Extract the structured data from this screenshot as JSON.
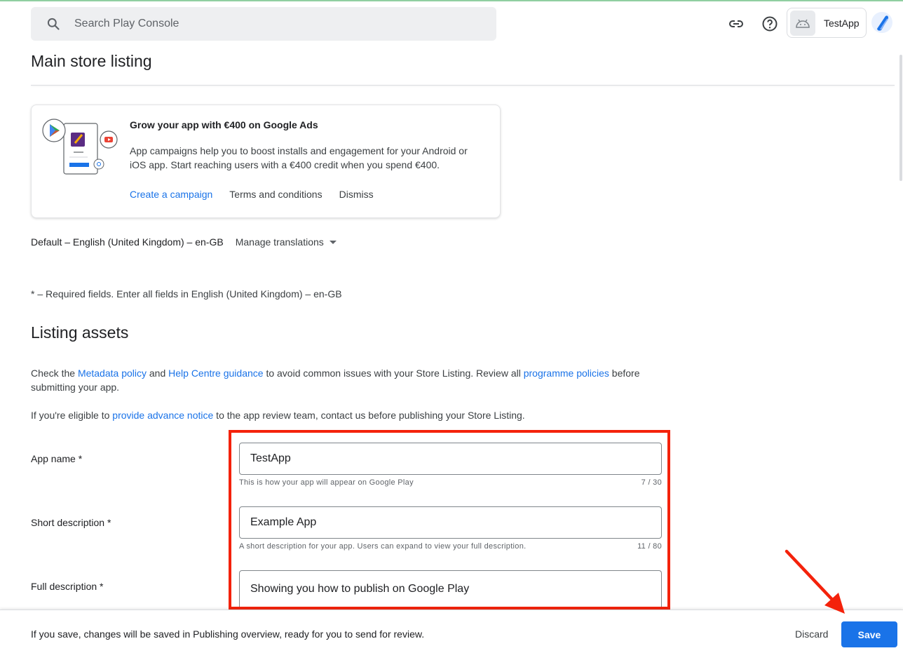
{
  "header": {
    "search_placeholder": "Search Play Console",
    "app_name": "TestApp",
    "icons": [
      "search-icon",
      "link-icon",
      "help-icon",
      "android-icon",
      "avatar"
    ]
  },
  "page": {
    "title": "Main store listing"
  },
  "promo": {
    "title": "Grow your app with €400 on Google Ads",
    "body": "App campaigns help you to boost installs and engagement for your Android or iOS app. Start reaching users with a €400 credit when you spend €400.",
    "create_campaign": "Create a campaign",
    "terms": "Terms and conditions",
    "dismiss": "Dismiss"
  },
  "language": {
    "default": "Default – English (United Kingdom) – en-GB",
    "manage_translations": "Manage translations"
  },
  "required_note": "* – Required fields. Enter all fields in English (United Kingdom) – en-GB",
  "listing_assets": {
    "heading": "Listing assets",
    "p1_a": "Check the ",
    "p1_metadata": "Metadata policy",
    "p1_b": " and ",
    "p1_help": "Help Centre guidance",
    "p1_c": " to avoid common issues with your Store Listing. Review all ",
    "p1_programme": "programme policies",
    "p1_d": " before submitting your app.",
    "p2_a": "If you're eligible to ",
    "p2_link": "provide advance notice",
    "p2_b": " to the app review team, contact us before publishing your Store Listing."
  },
  "fields": {
    "app_name": {
      "label": "App name  *",
      "value": "TestApp",
      "helper": "This is how your app will appear on Google Play",
      "counter": "7 / 30"
    },
    "short_description": {
      "label": "Short description  *",
      "value": "Example App",
      "helper": "A short description for your app. Users can expand to view your full description.",
      "counter": "11 / 80"
    },
    "full_description": {
      "label": "Full description  *",
      "value": "Showing you how to publish on Google Play"
    }
  },
  "footer": {
    "message": "If you save, changes will be saved in Publishing overview, ready for you to send for review.",
    "discard": "Discard",
    "save": "Save"
  },
  "colors": {
    "accent": "#1a73e8",
    "annotation": "#f4220b"
  }
}
